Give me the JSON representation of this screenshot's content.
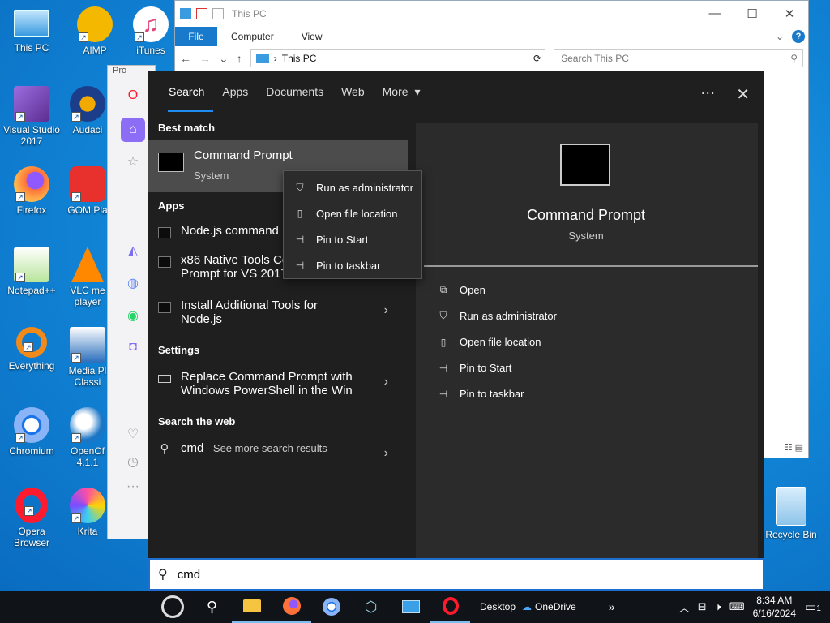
{
  "desktop": {
    "icons": [
      {
        "label": "This PC"
      },
      {
        "label": "AIMP"
      },
      {
        "label": "iTunes"
      },
      {
        "label": "Visual Studio 2017"
      },
      {
        "label": "Audaci"
      },
      {
        "label": "Firefox"
      },
      {
        "label": "GOM Pla"
      },
      {
        "label": "Notepad++"
      },
      {
        "label": "VLC me player"
      },
      {
        "label": "Everything"
      },
      {
        "label": "Media Pl Classi"
      },
      {
        "label": "Chromium"
      },
      {
        "label": "OpenOf 4.1.1"
      },
      {
        "label": "Opera Browser"
      },
      {
        "label": "Krita"
      }
    ],
    "recycle_bin": "Recycle Bin"
  },
  "explorer": {
    "title": "This PC",
    "ribbon_tabs": [
      "File",
      "Computer",
      "View"
    ],
    "address": "This PC",
    "search_placeholder": "Search This PC"
  },
  "opera_window": {
    "title": "Pro"
  },
  "search_flyout": {
    "tabs": [
      "Search",
      "Apps",
      "Documents",
      "Web",
      "More"
    ],
    "more_glyph": "▾",
    "ellipsis": "···",
    "close": "✕",
    "best_match_header": "Best match",
    "best_match": {
      "title": "Command Prompt",
      "subtitle": "System"
    },
    "apps_header": "Apps",
    "apps": [
      {
        "line1": "Node.js command",
        "line2": ""
      },
      {
        "line1": "x86 Native Tools Co",
        "line2": "Prompt for VS 2017"
      },
      {
        "line1": "Install Additional Tools for",
        "line2": "Node.js"
      }
    ],
    "settings_header": "Settings",
    "settings": [
      {
        "line1": "Replace Command Prompt with",
        "line2": "Windows PowerShell in the Win"
      }
    ],
    "web_header": "Search the web",
    "web": {
      "query": "cmd",
      "suffix": " - See more search results"
    },
    "preview": {
      "title": "Command Prompt",
      "subtitle": "System",
      "actions": [
        "Open",
        "Run as administrator",
        "Open file location",
        "Pin to Start",
        "Pin to taskbar"
      ]
    }
  },
  "context_menu": {
    "items": [
      "Run as administrator",
      "Open file location",
      "Pin to Start",
      "Pin to taskbar"
    ]
  },
  "search_box": {
    "value": "cmd"
  },
  "taskbar": {
    "desktop_label": "Desktop",
    "onedrive_label": "OneDrive",
    "overflow": "»",
    "time": "8:34 AM",
    "date": "6/16/2024",
    "notification_count": "1"
  },
  "colors": {
    "accent": "#1e8cf0",
    "flyout_bg": "#1f1f1f",
    "preview_bg": "#2b2b2b",
    "taskbar": "#101418"
  }
}
